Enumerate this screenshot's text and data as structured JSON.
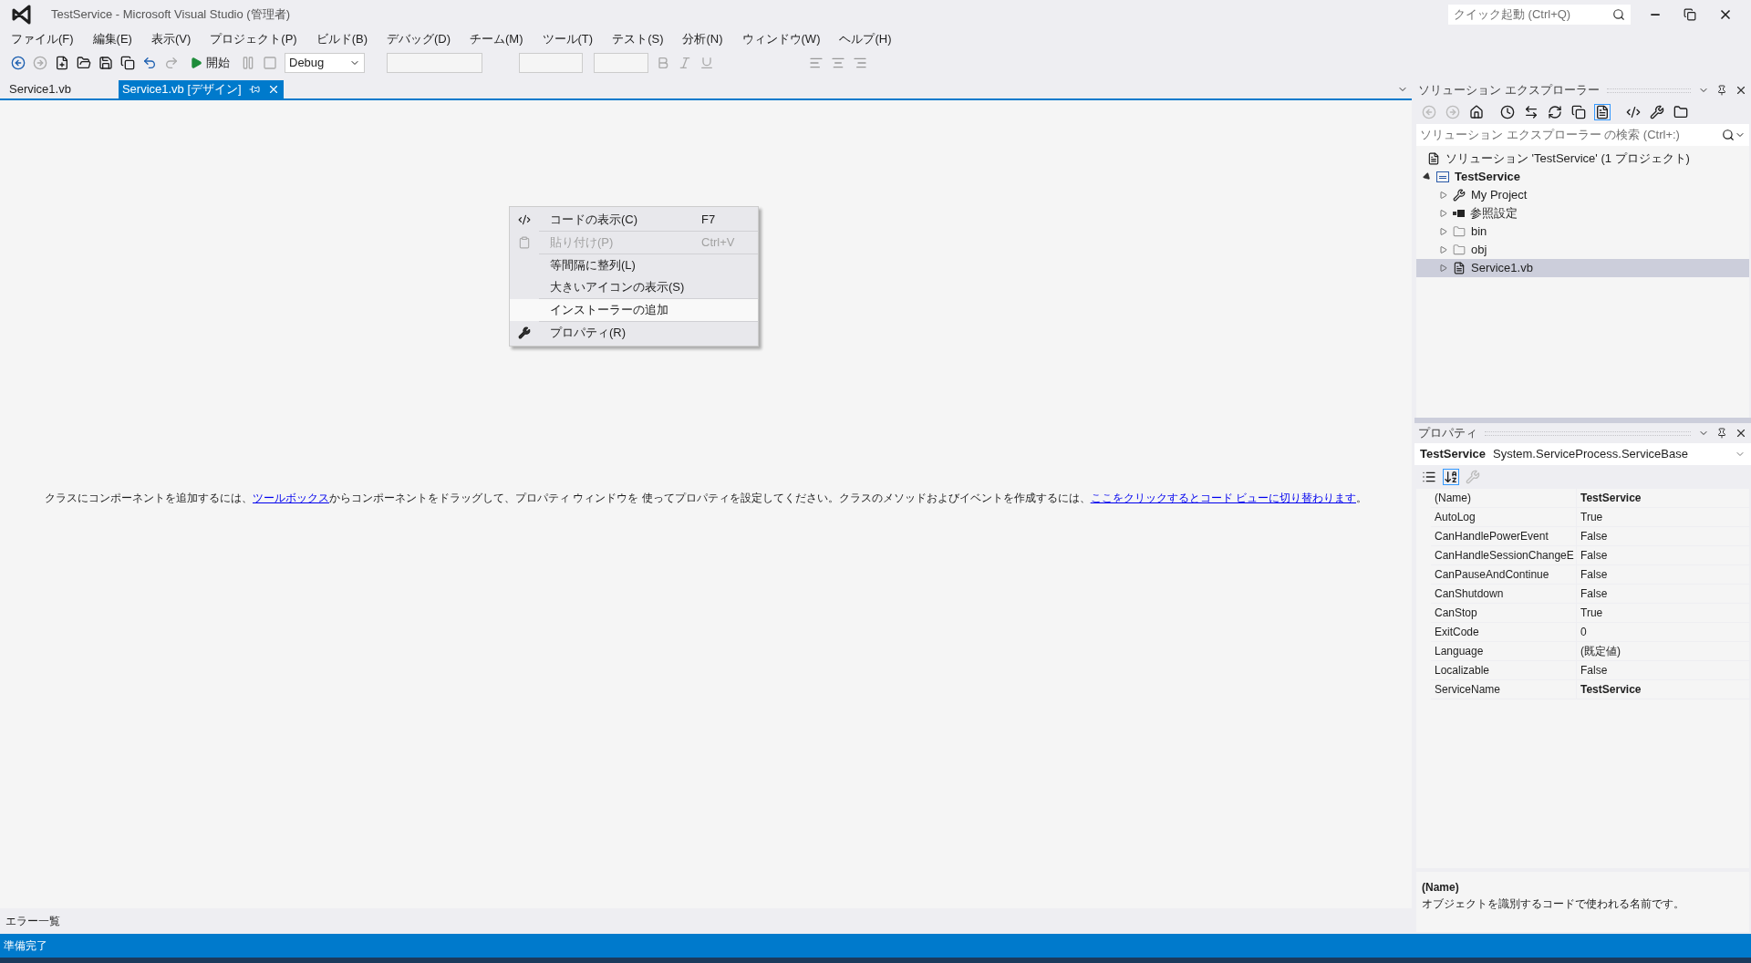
{
  "window": {
    "title": "TestService - Microsoft Visual Studio (管理者)",
    "quick_launch": {
      "placeholder": "クイック起動 (Ctrl+Q)"
    }
  },
  "menu": [
    "ファイル(F)",
    "編集(E)",
    "表示(V)",
    "プロジェクト(P)",
    "ビルド(B)",
    "デバッグ(D)",
    "チーム(M)",
    "ツール(T)",
    "テスト(S)",
    "分析(N)",
    "ウィンドウ(W)",
    "ヘルプ(H)"
  ],
  "toolbar": {
    "start": "開始",
    "configuration": "Debug"
  },
  "tabs": [
    {
      "label": "Service1.vb",
      "selected": false
    },
    {
      "label": "Service1.vb [デザイン]",
      "selected": true
    }
  ],
  "designer": {
    "parts": [
      {
        "kind": "text",
        "text": "クラスにコンポーネントを追加するには、"
      },
      {
        "kind": "link",
        "text": "ツールボックス"
      },
      {
        "kind": "text",
        "text": "からコンポーネントをドラッグして、プロパティ ウィンドウを 使ってプロパティを設定してください。クラスのメソッドおよびイベントを作成するには、"
      },
      {
        "kind": "link",
        "text": "ここをクリックするとコード ビューに切り替わります"
      },
      {
        "kind": "text",
        "text": "。"
      }
    ]
  },
  "context_menu": [
    {
      "kind": "code",
      "label": "コードの表示(C)",
      "shortcut": "F7",
      "disabled": false,
      "selected": false
    },
    {
      "kind": "paste",
      "label": "貼り付け(P)",
      "shortcut": "Ctrl+V",
      "disabled": true,
      "selected": false
    },
    {
      "kind": "plain",
      "label": "等間隔に整列(L)",
      "disabled": false,
      "selected": false
    },
    {
      "kind": "plain",
      "label": "大きいアイコンの表示(S)",
      "disabled": false,
      "selected": false
    },
    {
      "kind": "plain",
      "label": "インストーラーの追加",
      "disabled": false,
      "selected": true
    },
    {
      "kind": "wrench",
      "label": "プロパティ(R)",
      "disabled": false,
      "selected": false
    }
  ],
  "solution_explorer": {
    "title": "ソリューション エクスプローラー",
    "search": {
      "placeholder": "ソリューション エクスプローラー の検索 (Ctrl+:)"
    },
    "solution": {
      "label": "ソリューション 'TestService' (1 プロジェクト)",
      "children": [
        {
          "kind": "project",
          "label": "TestService",
          "expanded": true,
          "selected": false,
          "children": [
            {
              "kind": "wrench",
              "label": "My Project",
              "expanded": false,
              "selected": false
            },
            {
              "kind": "references",
              "label": "参照設定",
              "expanded": false,
              "selected": false
            },
            {
              "kind": "folder",
              "label": "bin",
              "expanded": false,
              "selected": false
            },
            {
              "kind": "folder",
              "label": "obj",
              "expanded": false,
              "selected": false
            },
            {
              "kind": "file",
              "label": "Service1.vb",
              "expanded": false,
              "selected": true
            }
          ]
        }
      ]
    }
  },
  "properties": {
    "title": "プロパティ",
    "object": {
      "name": "TestService",
      "type": "System.ServiceProcess.ServiceBase"
    },
    "rows": [
      {
        "name": "(Name)",
        "value": "TestService",
        "modified": true
      },
      {
        "name": "AutoLog",
        "value": "True",
        "modified": false
      },
      {
        "name": "CanHandlePowerEvent",
        "value": "False",
        "modified": false
      },
      {
        "name": "CanHandleSessionChangeE",
        "value": "False",
        "modified": false
      },
      {
        "name": "CanPauseAndContinue",
        "value": "False",
        "modified": false
      },
      {
        "name": "CanShutdown",
        "value": "False",
        "modified": false
      },
      {
        "name": "CanStop",
        "value": "True",
        "modified": false
      },
      {
        "name": "ExitCode",
        "value": "0",
        "modified": false
      },
      {
        "name": "Language",
        "value": "(既定値)",
        "modified": false
      },
      {
        "name": "Localizable",
        "value": "False",
        "modified": false
      },
      {
        "name": "ServiceName",
        "value": "TestService",
        "modified": true
      }
    ],
    "description": {
      "title": "(Name)",
      "text": "オブジェクトを識別するコードで使われる名前です。"
    }
  },
  "bottom_tabs": [
    "エラー一覧"
  ],
  "status_bar": {
    "text": "準備完了"
  }
}
